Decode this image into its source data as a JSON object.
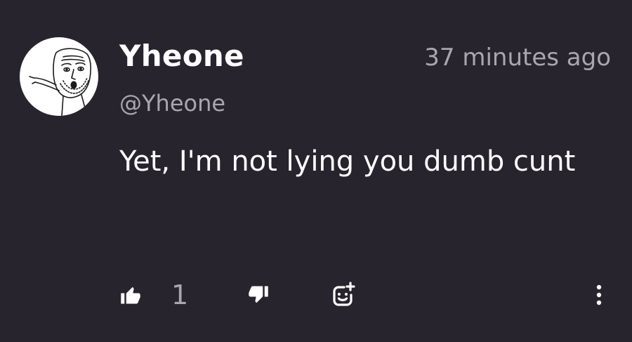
{
  "comment": {
    "author": {
      "display_name": "Yheone",
      "handle": "@Yheone",
      "avatar": "wojak-pointing-avatar"
    },
    "timestamp": "37 minutes ago",
    "text": "Yet, I'm not lying you dumb cunt",
    "actions": {
      "like_icon": "thumbs-up-icon",
      "like_count": "1",
      "dislike_icon": "thumbs-down-icon",
      "reaction_icon": "add-reaction-icon",
      "more_icon": "more-vertical-icon"
    }
  },
  "colors": {
    "background": "#27242d",
    "primary_text": "#ffffff",
    "secondary_text": "#a9a6ae"
  }
}
